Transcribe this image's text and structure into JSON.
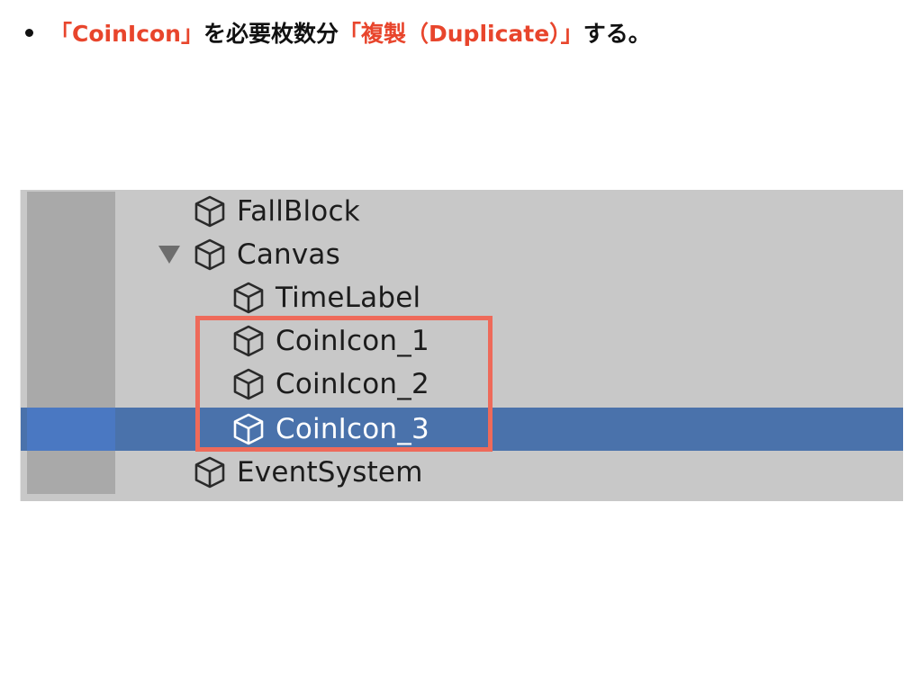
{
  "instruction": {
    "part1": "「CoinIcon」",
    "part2": "を必要枚数分",
    "part3": "「複製（Duplicate）」",
    "part4": "する。"
  },
  "colors": {
    "highlight_text": "#e8452c",
    "panel_bg": "#c8c8c8",
    "gutter_bg": "#a9a9a9",
    "selected_row": "#4a72ab",
    "annotation_box": "#ee6a5a"
  },
  "hierarchy": {
    "items": [
      {
        "label": "FallBlock",
        "icon": "cube-icon",
        "expanded_arrow": false,
        "selected": false
      },
      {
        "label": "Canvas",
        "icon": "cube-icon",
        "expanded_arrow": true,
        "selected": false
      },
      {
        "label": "TimeLabel",
        "icon": "cube-icon",
        "expanded_arrow": false,
        "selected": false
      },
      {
        "label": "CoinIcon_1",
        "icon": "cube-icon",
        "expanded_arrow": false,
        "selected": false
      },
      {
        "label": "CoinIcon_2",
        "icon": "cube-icon",
        "expanded_arrow": false,
        "selected": false
      },
      {
        "label": "CoinIcon_3",
        "icon": "cube-icon",
        "expanded_arrow": false,
        "selected": true
      },
      {
        "label": "EventSystem",
        "icon": "cube-icon",
        "expanded_arrow": false,
        "selected": false
      }
    ]
  }
}
